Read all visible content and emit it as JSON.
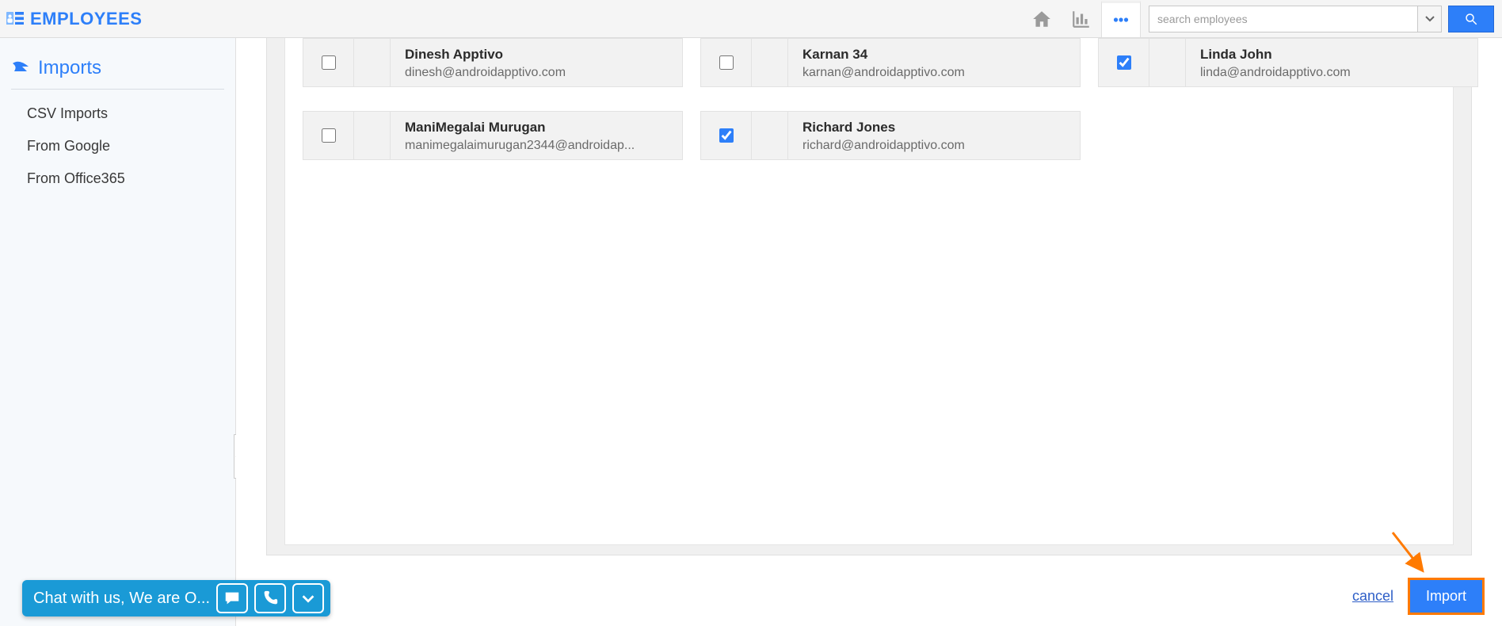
{
  "app": {
    "title": "EMPLOYEES"
  },
  "search": {
    "placeholder": "search employees"
  },
  "sidebar": {
    "heading": "Imports",
    "items": [
      {
        "label": "CSV Imports"
      },
      {
        "label": "From Google"
      },
      {
        "label": "From Office365"
      }
    ]
  },
  "employees": [
    {
      "name": "Dinesh Apptivo",
      "email": "dinesh@androidapptivo.com",
      "checked": false
    },
    {
      "name": "Karnan 34",
      "email": "karnan@androidapptivo.com",
      "checked": false
    },
    {
      "name": "Linda John",
      "email": "linda@androidapptivo.com",
      "checked": true
    },
    {
      "name": "ManiMegalai Murugan",
      "email": "manimegalaimurugan2344@androidap...",
      "checked": false
    },
    {
      "name": "Richard Jones",
      "email": "richard@androidapptivo.com",
      "checked": true
    }
  ],
  "actions": {
    "cancel": "cancel",
    "import": "Import"
  },
  "chat": {
    "text": "Chat with us, We are O..."
  },
  "colors": {
    "primary": "#2d7ff9",
    "highlight": "#ff7a00",
    "chat": "#1a9ad6"
  }
}
